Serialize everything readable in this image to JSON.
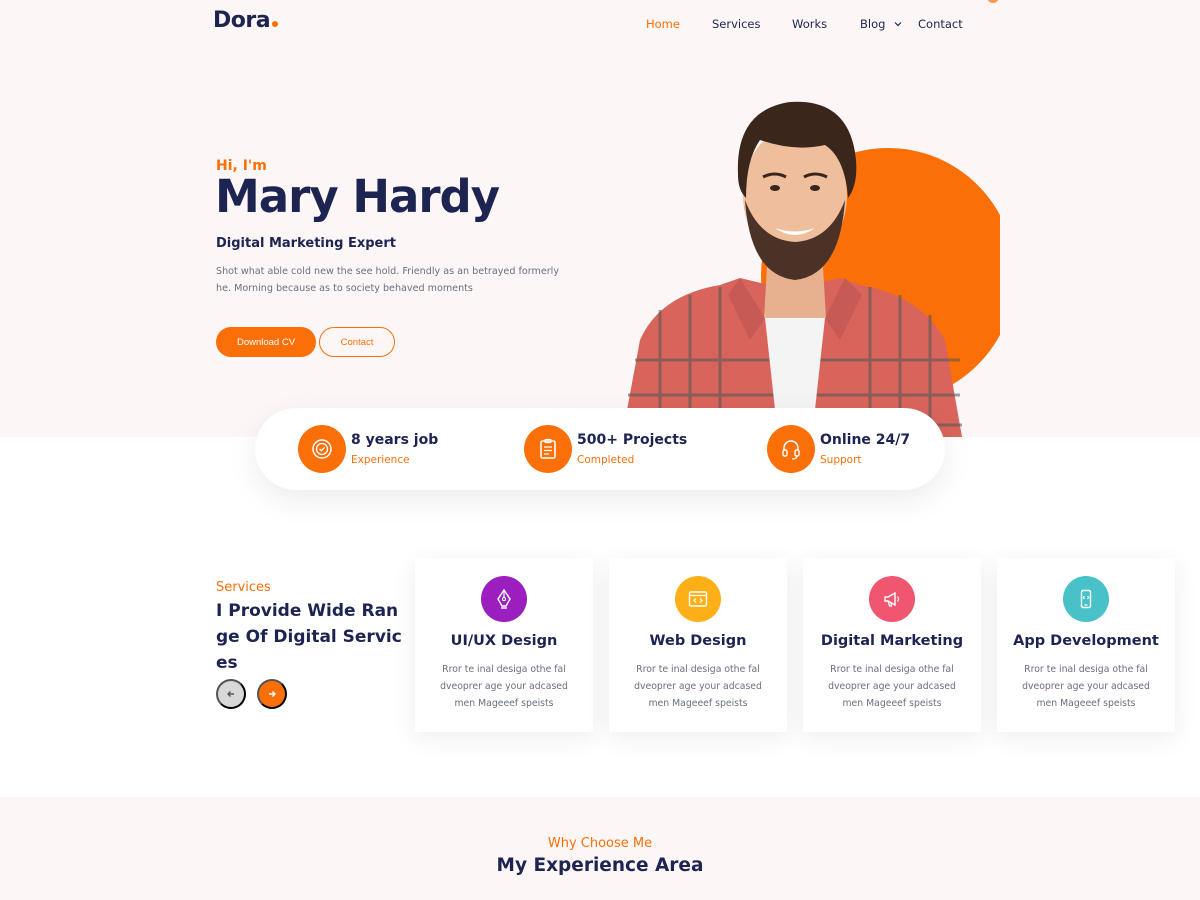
{
  "brand": {
    "name": "Dora",
    "accent": "#fb6f09",
    "primary": "#1d2452"
  },
  "nav": {
    "items": [
      {
        "label": "Home",
        "active": true
      },
      {
        "label": "Services"
      },
      {
        "label": "Works"
      },
      {
        "label": "Blog",
        "has_dropdown": true
      },
      {
        "label": "Contact"
      }
    ]
  },
  "hero": {
    "greeting": "Hi, I'm",
    "name": "Mary Hardy",
    "role": "Digital Marketing Expert",
    "description": "Shot what able cold new the see hold. Friendly as an betrayed formerly he. Morning because as to society behaved moments",
    "primary_button": "Download CV",
    "secondary_button": "Contact"
  },
  "stats": [
    {
      "title": "8 years job",
      "subtitle": "Experience",
      "icon": "badge-check-icon"
    },
    {
      "title": "500+ Projects",
      "subtitle": "Completed",
      "icon": "clipboard-icon"
    },
    {
      "title": "Online 24/7",
      "subtitle": "Support",
      "icon": "headset-icon"
    }
  ],
  "services": {
    "subtitle": "Services",
    "title": "I Provide Wide Range Of Digital Services",
    "prev_icon": "arrow-left-icon",
    "next_icon": "arrow-right-icon",
    "cards": [
      {
        "title": "UI/UX Design",
        "text": "Rror te inal desiga othe fal dveoprer age your adcased men Mageeef speists",
        "icon": "pen-tool-icon",
        "color": "#9b1fbf"
      },
      {
        "title": "Web Design",
        "text": "Rror te inal desiga othe fal dveoprer age your adcased men Mageeef speists",
        "icon": "browser-code-icon",
        "color": "#fcaf17"
      },
      {
        "title": "Digital Marketing",
        "text": "Rror te inal desiga othe fal dveoprer age your adcased men Mageeef speists",
        "icon": "megaphone-icon",
        "color": "#f0566f"
      },
      {
        "title": "App Development",
        "text": "Rror te inal desiga othe fal dveoprer age your adcased men Mageeef speists",
        "icon": "smartphone-code-icon",
        "color": "#48c1c8"
      }
    ]
  },
  "experience": {
    "subtitle": "Why Choose Me",
    "title": "My Experience Area"
  }
}
